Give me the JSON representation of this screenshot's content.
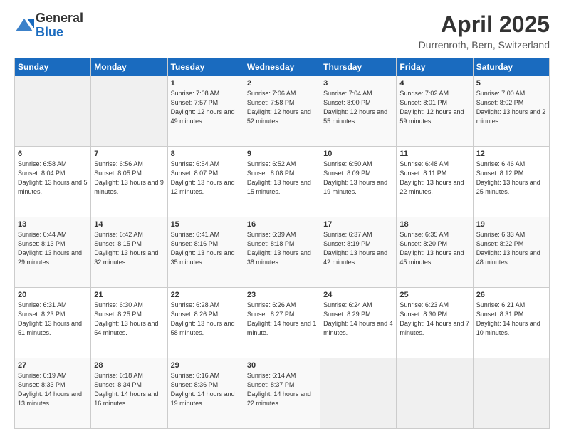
{
  "header": {
    "logo_general": "General",
    "logo_blue": "Blue",
    "month_title": "April 2025",
    "location": "Durrenroth, Bern, Switzerland"
  },
  "days_of_week": [
    "Sunday",
    "Monday",
    "Tuesday",
    "Wednesday",
    "Thursday",
    "Friday",
    "Saturday"
  ],
  "weeks": [
    [
      {
        "day": "",
        "info": ""
      },
      {
        "day": "",
        "info": ""
      },
      {
        "day": "1",
        "info": "Sunrise: 7:08 AM\nSunset: 7:57 PM\nDaylight: 12 hours and 49 minutes."
      },
      {
        "day": "2",
        "info": "Sunrise: 7:06 AM\nSunset: 7:58 PM\nDaylight: 12 hours and 52 minutes."
      },
      {
        "day": "3",
        "info": "Sunrise: 7:04 AM\nSunset: 8:00 PM\nDaylight: 12 hours and 55 minutes."
      },
      {
        "day": "4",
        "info": "Sunrise: 7:02 AM\nSunset: 8:01 PM\nDaylight: 12 hours and 59 minutes."
      },
      {
        "day": "5",
        "info": "Sunrise: 7:00 AM\nSunset: 8:02 PM\nDaylight: 13 hours and 2 minutes."
      }
    ],
    [
      {
        "day": "6",
        "info": "Sunrise: 6:58 AM\nSunset: 8:04 PM\nDaylight: 13 hours and 5 minutes."
      },
      {
        "day": "7",
        "info": "Sunrise: 6:56 AM\nSunset: 8:05 PM\nDaylight: 13 hours and 9 minutes."
      },
      {
        "day": "8",
        "info": "Sunrise: 6:54 AM\nSunset: 8:07 PM\nDaylight: 13 hours and 12 minutes."
      },
      {
        "day": "9",
        "info": "Sunrise: 6:52 AM\nSunset: 8:08 PM\nDaylight: 13 hours and 15 minutes."
      },
      {
        "day": "10",
        "info": "Sunrise: 6:50 AM\nSunset: 8:09 PM\nDaylight: 13 hours and 19 minutes."
      },
      {
        "day": "11",
        "info": "Sunrise: 6:48 AM\nSunset: 8:11 PM\nDaylight: 13 hours and 22 minutes."
      },
      {
        "day": "12",
        "info": "Sunrise: 6:46 AM\nSunset: 8:12 PM\nDaylight: 13 hours and 25 minutes."
      }
    ],
    [
      {
        "day": "13",
        "info": "Sunrise: 6:44 AM\nSunset: 8:13 PM\nDaylight: 13 hours and 29 minutes."
      },
      {
        "day": "14",
        "info": "Sunrise: 6:42 AM\nSunset: 8:15 PM\nDaylight: 13 hours and 32 minutes."
      },
      {
        "day": "15",
        "info": "Sunrise: 6:41 AM\nSunset: 8:16 PM\nDaylight: 13 hours and 35 minutes."
      },
      {
        "day": "16",
        "info": "Sunrise: 6:39 AM\nSunset: 8:18 PM\nDaylight: 13 hours and 38 minutes."
      },
      {
        "day": "17",
        "info": "Sunrise: 6:37 AM\nSunset: 8:19 PM\nDaylight: 13 hours and 42 minutes."
      },
      {
        "day": "18",
        "info": "Sunrise: 6:35 AM\nSunset: 8:20 PM\nDaylight: 13 hours and 45 minutes."
      },
      {
        "day": "19",
        "info": "Sunrise: 6:33 AM\nSunset: 8:22 PM\nDaylight: 13 hours and 48 minutes."
      }
    ],
    [
      {
        "day": "20",
        "info": "Sunrise: 6:31 AM\nSunset: 8:23 PM\nDaylight: 13 hours and 51 minutes."
      },
      {
        "day": "21",
        "info": "Sunrise: 6:30 AM\nSunset: 8:25 PM\nDaylight: 13 hours and 54 minutes."
      },
      {
        "day": "22",
        "info": "Sunrise: 6:28 AM\nSunset: 8:26 PM\nDaylight: 13 hours and 58 minutes."
      },
      {
        "day": "23",
        "info": "Sunrise: 6:26 AM\nSunset: 8:27 PM\nDaylight: 14 hours and 1 minute."
      },
      {
        "day": "24",
        "info": "Sunrise: 6:24 AM\nSunset: 8:29 PM\nDaylight: 14 hours and 4 minutes."
      },
      {
        "day": "25",
        "info": "Sunrise: 6:23 AM\nSunset: 8:30 PM\nDaylight: 14 hours and 7 minutes."
      },
      {
        "day": "26",
        "info": "Sunrise: 6:21 AM\nSunset: 8:31 PM\nDaylight: 14 hours and 10 minutes."
      }
    ],
    [
      {
        "day": "27",
        "info": "Sunrise: 6:19 AM\nSunset: 8:33 PM\nDaylight: 14 hours and 13 minutes."
      },
      {
        "day": "28",
        "info": "Sunrise: 6:18 AM\nSunset: 8:34 PM\nDaylight: 14 hours and 16 minutes."
      },
      {
        "day": "29",
        "info": "Sunrise: 6:16 AM\nSunset: 8:36 PM\nDaylight: 14 hours and 19 minutes."
      },
      {
        "day": "30",
        "info": "Sunrise: 6:14 AM\nSunset: 8:37 PM\nDaylight: 14 hours and 22 minutes."
      },
      {
        "day": "",
        "info": ""
      },
      {
        "day": "",
        "info": ""
      },
      {
        "day": "",
        "info": ""
      }
    ]
  ]
}
